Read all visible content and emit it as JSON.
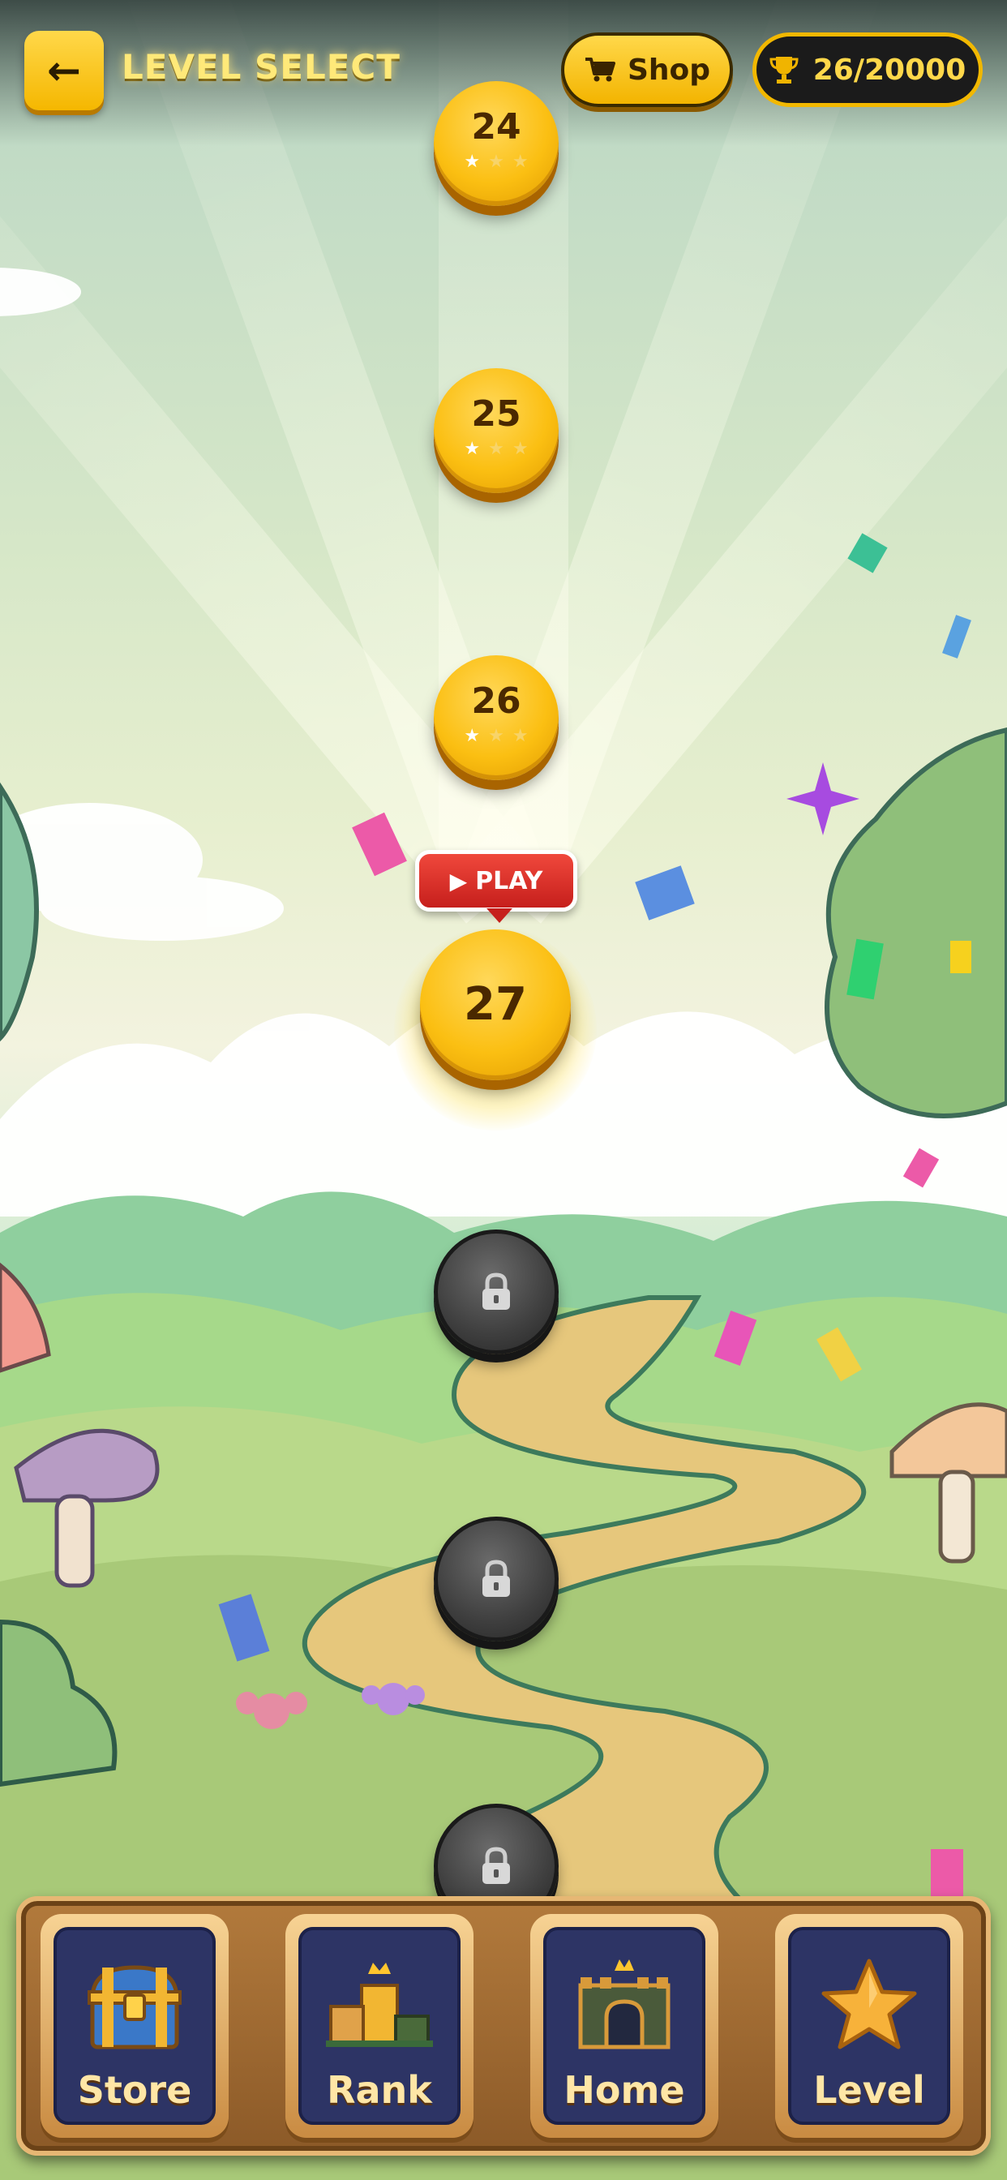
{
  "header": {
    "back_icon": "arrow-left-icon",
    "title": "LEVEL SELECT",
    "shop_label": "Shop",
    "shop_icon": "cart-icon",
    "trophy_icon": "trophy-icon",
    "trophy_count": "26/20000"
  },
  "levels": [
    {
      "number": "24",
      "status": "completed",
      "stars": 1
    },
    {
      "number": "25",
      "status": "completed",
      "stars": 1
    },
    {
      "number": "26",
      "status": "completed",
      "stars": 1
    },
    {
      "number": "27",
      "status": "current"
    },
    {
      "number": "",
      "status": "locked"
    },
    {
      "number": "",
      "status": "locked"
    },
    {
      "number": "",
      "status": "locked"
    }
  ],
  "play_button": {
    "label": "PLAY",
    "icon": "play-icon"
  },
  "nav": {
    "items": [
      {
        "label": "Store",
        "icon": "treasure-chest-icon"
      },
      {
        "label": "Rank",
        "icon": "podium-icon"
      },
      {
        "label": "Home",
        "icon": "castle-icon"
      },
      {
        "label": "Level",
        "icon": "star-icon"
      }
    ]
  },
  "colors": {
    "gold": "#fbbf12",
    "play_red": "#d6291f",
    "locked_gray": "#3f3f3f",
    "nav_panel": "#2d3465"
  }
}
